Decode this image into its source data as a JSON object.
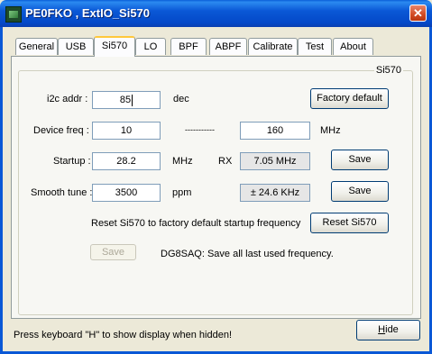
{
  "window": {
    "title": "PE0FKO , ExtIO_Si570",
    "close_glyph": "✕"
  },
  "tabs": [
    "General",
    "USB",
    "Si570",
    "LO",
    "BPF",
    "ABPF",
    "Calibrate",
    "Test",
    "About"
  ],
  "active_tab": "Si570",
  "group": {
    "label": "Si570"
  },
  "i2c": {
    "label": "i2c addr :",
    "value": "85",
    "unit": "dec"
  },
  "factory_default_button": "Factory default",
  "device_freq": {
    "label": "Device freq :",
    "min_value": "10",
    "separator": "-----------",
    "max_value": "160",
    "unit": "MHz"
  },
  "startup": {
    "label": "Startup :",
    "value": "28.2",
    "unit": "MHz",
    "rx_label": "RX",
    "rx_value": "7.05 MHz",
    "save_label": "Save"
  },
  "smooth_tune": {
    "label": "Smooth tune :",
    "value": "3500",
    "unit": "ppm",
    "range_value": "± 24.6 KHz",
    "save_label": "Save"
  },
  "reset": {
    "text": "Reset Si570 to factory default startup frequency",
    "button_label": "Reset Si570"
  },
  "save_all": {
    "button_label": "Save",
    "text": "DG8SAQ: Save all last used frequency."
  },
  "footer": {
    "hint": "Press keyboard \"H\" to show display when hidden!",
    "hide_prefix": "H",
    "hide_rest": "ide"
  }
}
